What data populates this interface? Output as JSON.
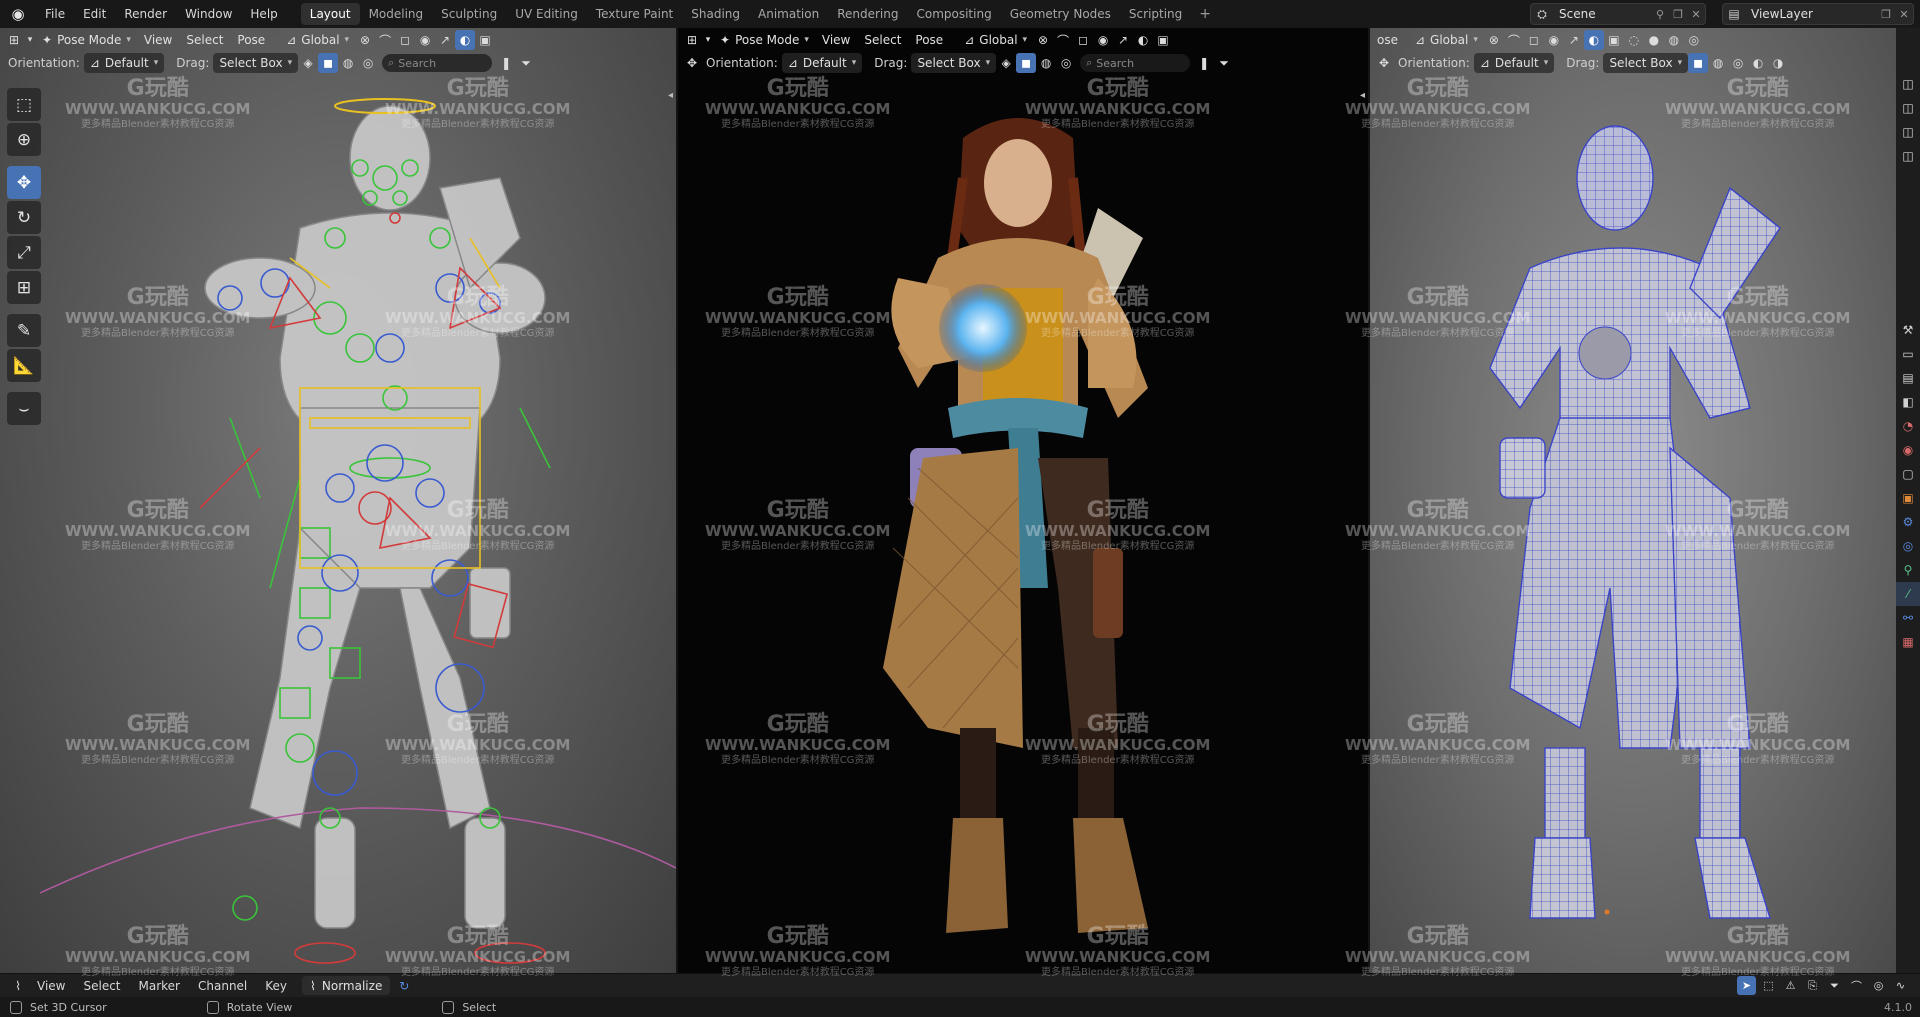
{
  "app": {
    "version": "4.1.0"
  },
  "menu": [
    "File",
    "Edit",
    "Render",
    "Window",
    "Help"
  ],
  "workspaces": [
    "Layout",
    "Modeling",
    "Sculpting",
    "UV Editing",
    "Texture Paint",
    "Shading",
    "Animation",
    "Rendering",
    "Compositing",
    "Geometry Nodes",
    "Scripting"
  ],
  "active_workspace": "Layout",
  "scene": {
    "name": "Scene"
  },
  "view_layer": {
    "name": "ViewLayer"
  },
  "viewports": [
    {
      "mode": "Pose Mode",
      "menus": [
        "View",
        "Select",
        "Pose"
      ],
      "transform_orientation": "Global",
      "orientation_label": "Orientation:",
      "orientation_value": "Default",
      "drag_label": "Drag:",
      "drag_value": "Select Box",
      "search_placeholder": "Search",
      "shading": "solid-xray",
      "content": "armature-rig-solid"
    },
    {
      "mode": "Pose Mode",
      "menus": [
        "View",
        "Select",
        "Pose"
      ],
      "transform_orientation": "Global",
      "orientation_label": "Orientation:",
      "orientation_value": "Default",
      "drag_label": "Drag:",
      "drag_value": "Select Box",
      "search_placeholder": "Search",
      "shading": "rendered",
      "content": "character-rendered"
    },
    {
      "mode": "ose",
      "menus": [],
      "transform_orientation": "Global",
      "orientation_label": "Orientation:",
      "orientation_value": "Default",
      "drag_label": "Drag:",
      "drag_value": "Select Box",
      "search_placeholder": "",
      "shading": "solid-wireframe",
      "content": "character-wireframe"
    }
  ],
  "tools": [
    "select-box-icon",
    "cursor-icon",
    "move-icon",
    "rotate-icon",
    "scale-icon",
    "transform-icon",
    "annotate-icon",
    "measure-icon",
    "relax-pose-icon"
  ],
  "active_tool": "move-icon",
  "watermark": {
    "logo": "G玩酷",
    "url": "WWW.WANKUCG.COM",
    "tagline": "更多精品Blender素材教程CG资源"
  },
  "timeline": {
    "menus": [
      "View",
      "Select",
      "Marker",
      "Channel",
      "Key"
    ],
    "normalize_label": "Normalize"
  },
  "statusbar": [
    {
      "icon": "left-mouse-icon",
      "label": "Set 3D Cursor"
    },
    {
      "icon": "middle-mouse-icon",
      "label": "Rotate View"
    },
    {
      "icon": "right-mouse-icon",
      "label": "Select"
    }
  ],
  "colors": {
    "active_blue": "#4772b3",
    "topbar": "#181818",
    "rig_green": "#39c43a",
    "rig_blue": "#3a5bd0",
    "rig_red": "#d23b3b",
    "rig_yellow": "#e8c020",
    "wire_blue": "#3a44c8"
  },
  "side_icons": [
    "tool-icon",
    "render-icon",
    "output-icon",
    "view-layer-icon",
    "scene-icon",
    "world-icon",
    "collection-icon",
    "object-icon",
    "modifier-icon",
    "physics-icon",
    "constraint-icon",
    "data-icon",
    "bone-icon",
    "bone-constraint-icon",
    "texture-icon"
  ]
}
